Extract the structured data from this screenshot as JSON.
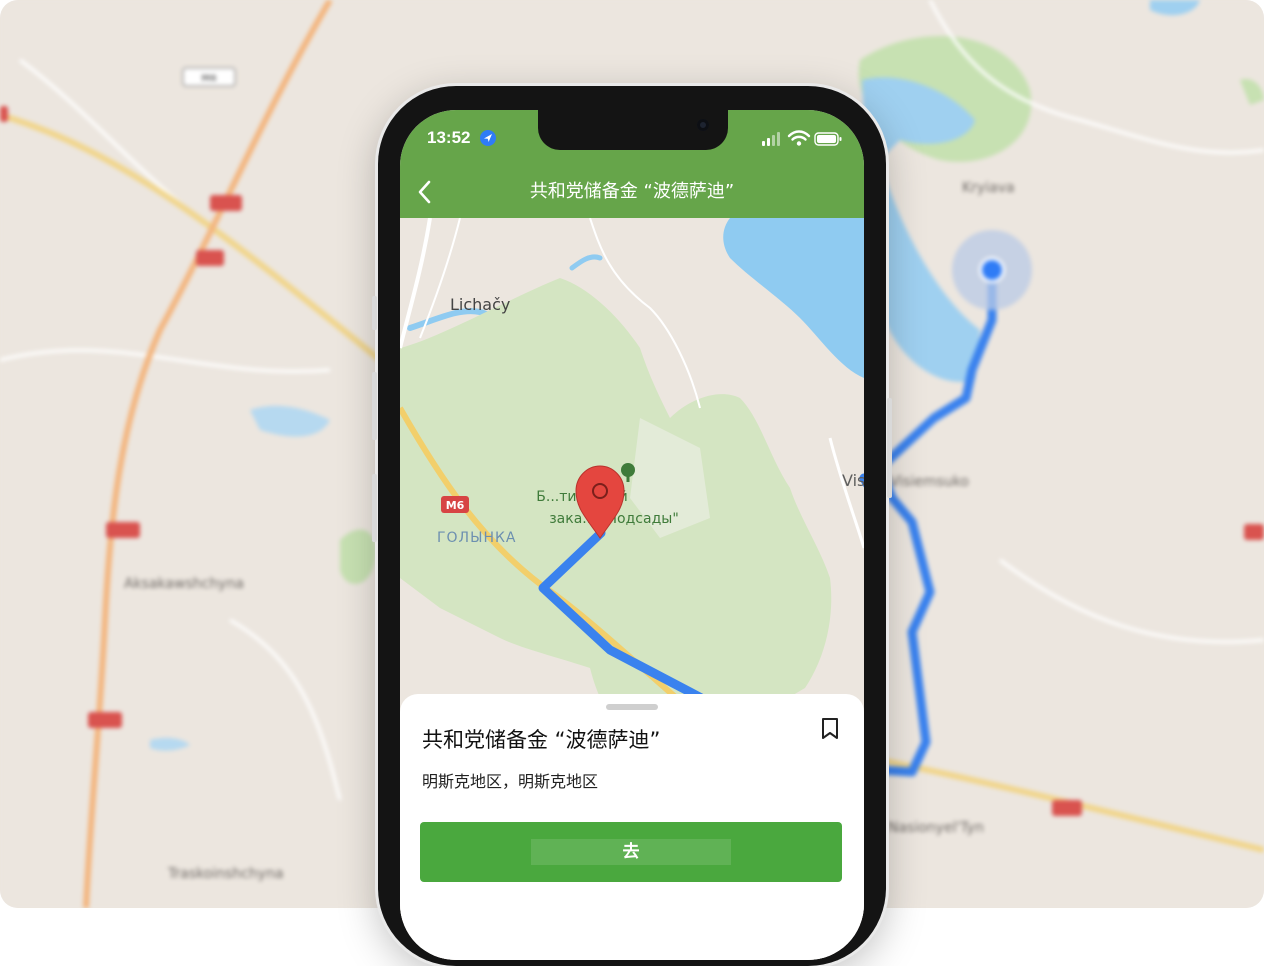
{
  "status_bar": {
    "time": "13:52"
  },
  "header": {
    "title": "共和党储备金 “波德萨迪”"
  },
  "map": {
    "labels": {
      "village_north": "Lichačy",
      "reserve_line1": "Б...тический",
      "reserve_line2": "зака... \"Подсады\"",
      "district": "ГОЛЫНКА",
      "right_edge": "Vis"
    },
    "road_badge": "M6",
    "background_labels": {
      "top_right": "Kryiava",
      "middle_right": "Visiemsuko",
      "left_middle": "Aksakawshchyna",
      "left_bottom": "Traskoinshchyna",
      "bottom_right": "Nasionyel'Tyn",
      "top_badge": "M6"
    }
  },
  "sheet": {
    "title": "共和党储备金 “波德萨迪”",
    "subtitle": "明斯克地区，明斯克地区",
    "go_button": "去"
  },
  "colors": {
    "header_green": "#66a54a",
    "button_green": "#4aa83e",
    "route_blue": "#3a82ee",
    "pin_red": "#e4463f",
    "water": "#8fcbf1",
    "forest": "#d4e5c2"
  }
}
